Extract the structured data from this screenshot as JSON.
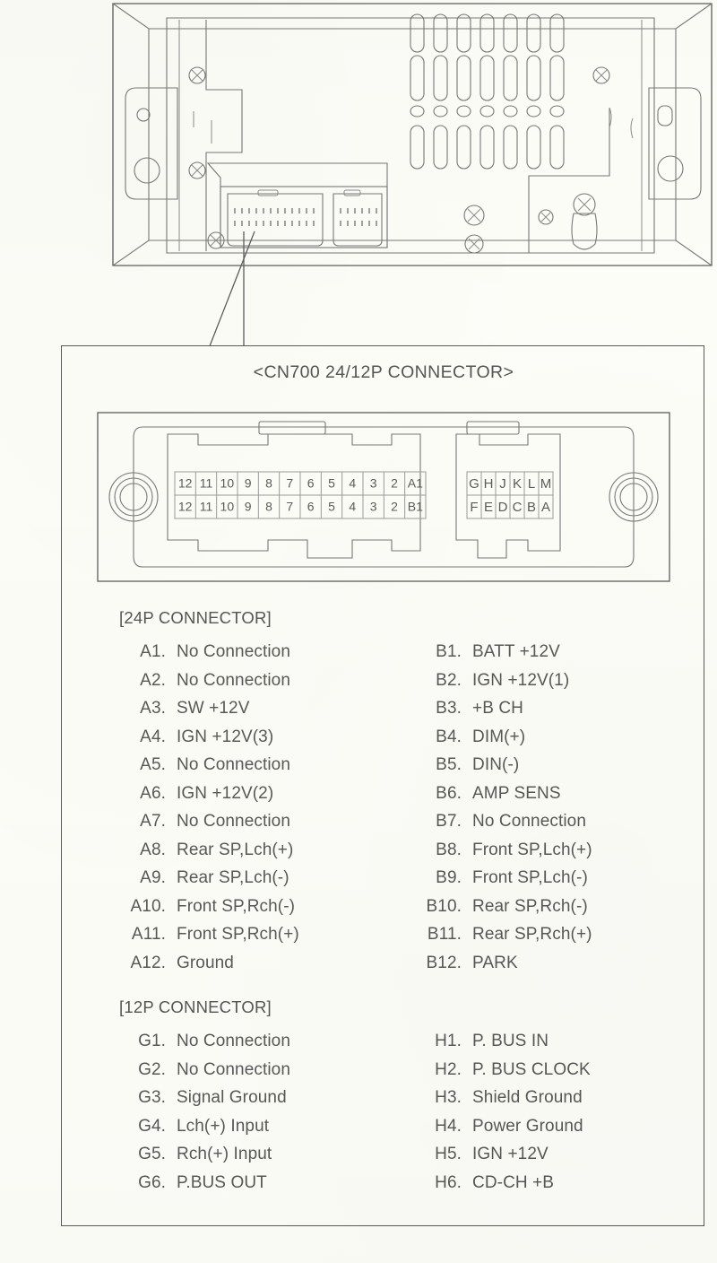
{
  "diagram": {
    "device_caption": "car-stereo-rear-view",
    "connector_title": "<CN700 24/12P CONNECTOR>"
  },
  "connector_graphic": {
    "p24_top_row": [
      "12",
      "11",
      "10",
      "9",
      "8",
      "7",
      "6",
      "5",
      "4",
      "3",
      "2",
      "A1"
    ],
    "p24_bottom_row": [
      "12",
      "11",
      "10",
      "9",
      "8",
      "7",
      "6",
      "5",
      "4",
      "3",
      "2",
      "B1"
    ],
    "p12_top_row": [
      "G",
      "H",
      "J",
      "K",
      "L",
      "M"
    ],
    "p12_bottom_row": [
      "F",
      "E",
      "D",
      "C",
      "B",
      "A"
    ]
  },
  "sections": [
    {
      "id": "p24",
      "heading": "[24P CONNECTOR]",
      "left_column": [
        {
          "pin": "A1.",
          "label": "No Connection"
        },
        {
          "pin": "A2.",
          "label": "No Connection"
        },
        {
          "pin": "A3.",
          "label": "SW +12V"
        },
        {
          "pin": "A4.",
          "label": "IGN +12V(3)"
        },
        {
          "pin": "A5.",
          "label": "No Connection"
        },
        {
          "pin": "A6.",
          "label": "IGN +12V(2)"
        },
        {
          "pin": "A7.",
          "label": "No Connection"
        },
        {
          "pin": "A8.",
          "label": "Rear SP,Lch(+)"
        },
        {
          "pin": "A9.",
          "label": "Rear SP,Lch(-)"
        },
        {
          "pin": "A10.",
          "label": "Front SP,Rch(-)"
        },
        {
          "pin": "A11.",
          "label": "Front SP,Rch(+)"
        },
        {
          "pin": "A12.",
          "label": "Ground"
        }
      ],
      "right_column": [
        {
          "pin": "B1.",
          "label": "BATT +12V"
        },
        {
          "pin": "B2.",
          "label": "IGN +12V(1)"
        },
        {
          "pin": "B3.",
          "label": "+B CH"
        },
        {
          "pin": "B4.",
          "label": "DIM(+)"
        },
        {
          "pin": "B5.",
          "label": "DIN(-)"
        },
        {
          "pin": "B6.",
          "label": "AMP SENS"
        },
        {
          "pin": "B7.",
          "label": "No Connection"
        },
        {
          "pin": "B8.",
          "label": "Front SP,Lch(+)"
        },
        {
          "pin": "B9.",
          "label": "Front SP,Lch(-)"
        },
        {
          "pin": "B10.",
          "label": "Rear SP,Rch(-)"
        },
        {
          "pin": "B11.",
          "label": "Rear SP,Rch(+)"
        },
        {
          "pin": "B12.",
          "label": "PARK"
        }
      ]
    },
    {
      "id": "p12",
      "heading": "[12P CONNECTOR]",
      "left_column": [
        {
          "pin": "G1.",
          "label": "No Connection"
        },
        {
          "pin": "G2.",
          "label": "No Connection"
        },
        {
          "pin": "G3.",
          "label": "Signal Ground"
        },
        {
          "pin": "G4.",
          "label": "Lch(+) Input"
        },
        {
          "pin": "G5.",
          "label": "Rch(+) Input"
        },
        {
          "pin": "G6.",
          "label": "P.BUS OUT"
        }
      ],
      "right_column": [
        {
          "pin": "H1.",
          "label": "P. BUS IN"
        },
        {
          "pin": "H2.",
          "label": "P. BUS CLOCK"
        },
        {
          "pin": "H3.",
          "label": "Shield Ground"
        },
        {
          "pin": "H4.",
          "label": "Power Ground"
        },
        {
          "pin": "H5.",
          "label": "IGN +12V"
        },
        {
          "pin": "H6.",
          "label": "CD-CH +B"
        }
      ]
    }
  ],
  "colors": {
    "paper": "#fdfdf8",
    "ink": "#585858",
    "line": "#777777",
    "border": "#5a5a5a"
  }
}
